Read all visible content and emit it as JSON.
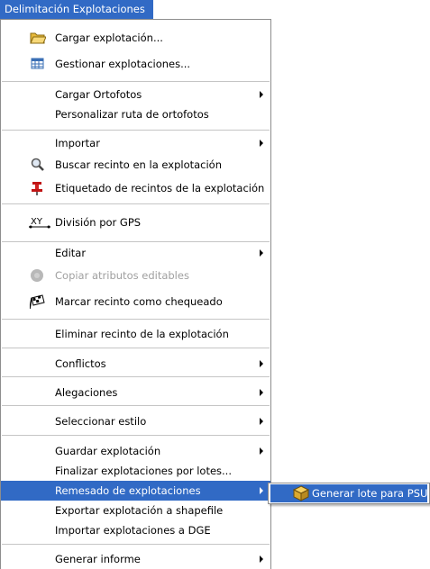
{
  "menu_title": "Delimitación Explotaciones",
  "items": {
    "cargar_explotacion": "Cargar explotación...",
    "gestionar_explotaciones": "Gestionar explotaciones...",
    "cargar_ortofotos": "Cargar Ortofotos",
    "personalizar_ruta": "Personalizar ruta de ortofotos",
    "importar": "Importar",
    "buscar_recinto": "Buscar recinto en la explotación",
    "etiquetado_recintos": "Etiquetado de recintos de la explotación",
    "division_gps": "División por GPS",
    "editar": "Editar",
    "copiar_atributos": "Copiar atributos editables",
    "marcar_recinto": "Marcar recinto como chequeado",
    "eliminar_recinto": "Eliminar recinto de la explotación",
    "conflictos": "Conflictos",
    "alegaciones": "Alegaciones",
    "seleccionar_estilo": "Seleccionar estilo",
    "guardar_explotacion": "Guardar explotación",
    "finalizar_lotes": "Finalizar explotaciones por lotes...",
    "remesado": "Remesado de explotaciones",
    "exportar_shapefile": "Exportar explotación a shapefile",
    "importar_dge": "Importar explotaciones a DGE",
    "generar_informe": "Generar informe"
  },
  "submenu": {
    "generar_lote_psu": "Generar lote para PSU"
  },
  "icons": {
    "cargar_explotacion": "folder-open-icon",
    "gestionar_explotaciones": "table-grid-icon",
    "buscar_recinto": "magnifier-icon",
    "etiquetado_recintos": "red-pin-icon",
    "division_gps": "xy-gps-icon",
    "copiar_atributos": "gray-disc-icon",
    "marcar_recinto": "checkered-flag-icon",
    "generar_lote_psu": "box-icon"
  },
  "icon_texts": {
    "division_gps": "XY"
  },
  "colors": {
    "highlight": "#316ac5",
    "separator": "#c5c5c5",
    "disabled_text": "#a0a0a0"
  }
}
